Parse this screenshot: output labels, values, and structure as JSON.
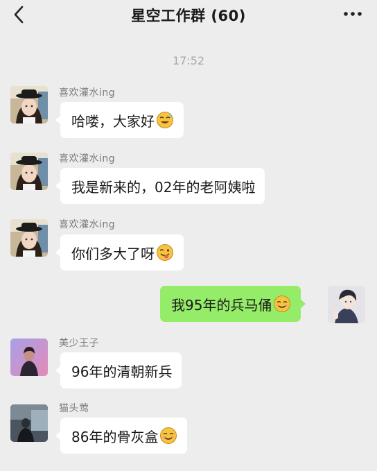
{
  "header": {
    "title": "星空工作群 (60)",
    "back_icon": "chevron-left-icon",
    "more_icon": "more-dots-icon"
  },
  "timestamp": "17:52",
  "messages": [
    {
      "sender": "喜欢灌水ing",
      "text": "哈喽，大家好",
      "emoji": "sweat-smile-emoji",
      "side": "left"
    },
    {
      "sender": "喜欢灌水ing",
      "text": "我是新来的，02年的老阿姨啦",
      "side": "left"
    },
    {
      "sender": "喜欢灌水ing",
      "text": "你们多大了呀",
      "emoji": "wink-tongue-emoji",
      "side": "left"
    },
    {
      "sender": "",
      "text": "我95年的兵马俑",
      "emoji": "smile-emoji",
      "side": "right"
    },
    {
      "sender": "美少王子",
      "text": "96年的清朝新兵",
      "side": "left"
    },
    {
      "sender": "猫头莺",
      "text": "86年的骨灰盒",
      "emoji": "smile-emoji",
      "side": "left"
    }
  ],
  "colors": {
    "background": "#ededed",
    "incoming_bubble": "#ffffff",
    "outgoing_bubble": "#95ec69"
  }
}
